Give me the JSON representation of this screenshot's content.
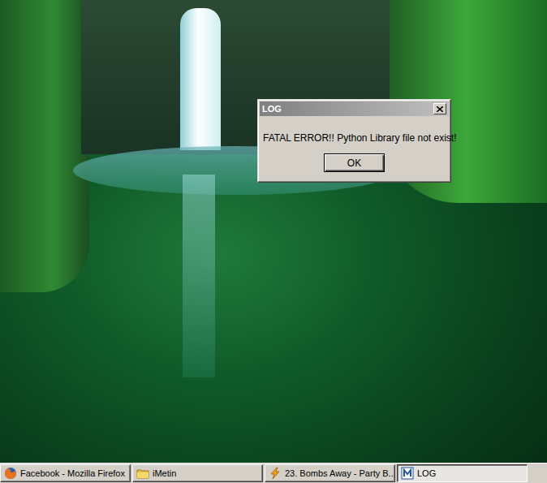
{
  "dialog": {
    "title": "LOG",
    "active": false,
    "message": "FATAL ERROR!! Python Library file not exist!",
    "buttons": [
      "OK"
    ]
  },
  "taskbar": {
    "items": [
      {
        "label": "Facebook - Mozilla Firefox",
        "kind": "firefox",
        "selected": false
      },
      {
        "label": "iMetin",
        "kind": "folder",
        "selected": false
      },
      {
        "label": "23. Bombs Away - Party B...",
        "kind": "player",
        "selected": false
      },
      {
        "label": "LOG",
        "kind": "app",
        "selected": true
      }
    ]
  }
}
